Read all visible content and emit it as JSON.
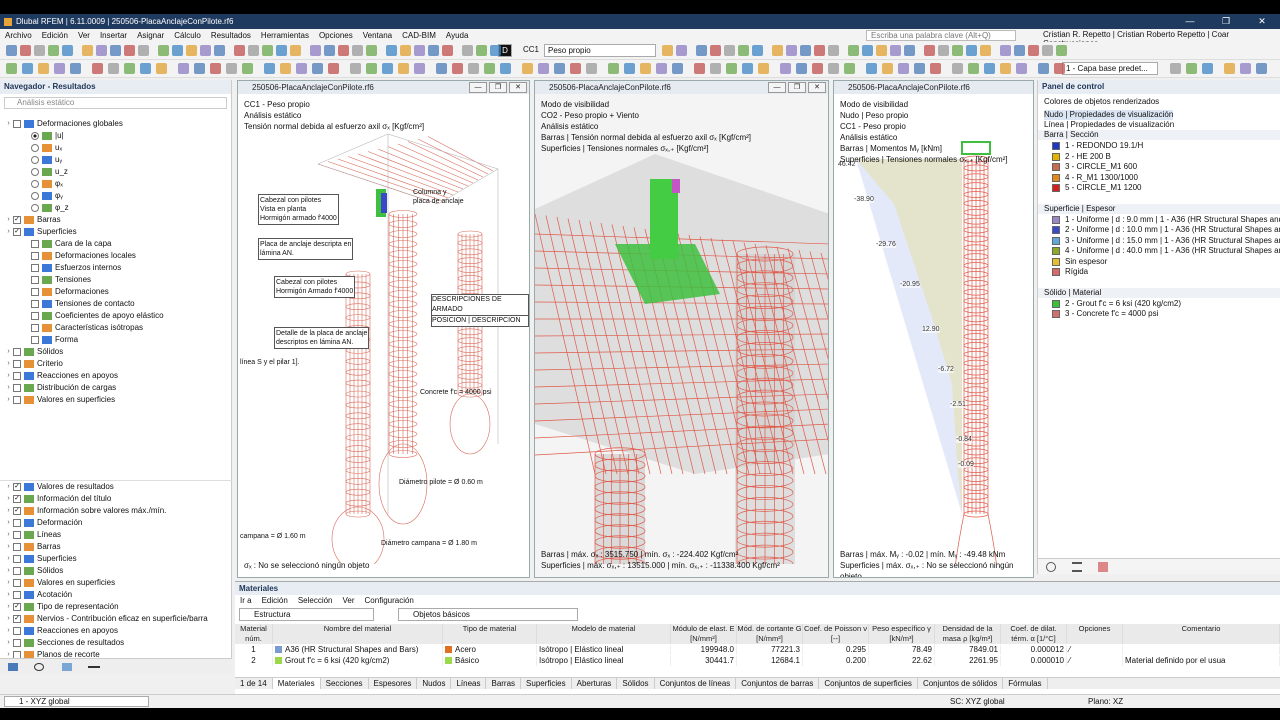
{
  "window": {
    "title": "Dlubal RFEM | 6.11.0009 | 250506-PlacaAnclajeConPilote.rf6",
    "min": "—",
    "max": "❐",
    "close": "✕"
  },
  "menu": [
    "Archivo",
    "Edición",
    "Ver",
    "Insertar",
    "Asignar",
    "Cálculo",
    "Resultados",
    "Herramientas",
    "Opciones",
    "Ventana",
    "CAD-BIM",
    "Ayuda"
  ],
  "search_placeholder": "Escriba una palabra clave (Alt+Q)",
  "user": "Cristian R. Repetto | Cristian Roberto Repetto | Coar Construcciones",
  "toolbar": {
    "load_case_badge": "D",
    "load_case_id": "CC1",
    "load_case_name": "Peso propio",
    "layer_combo": "1 - Capa base predet...",
    "coord_combo": "1 - XYZ global"
  },
  "navigator": {
    "title": "Navegador - Resultados",
    "subtitle": "Análisis estático",
    "top_tree": [
      {
        "label": "Deformaciones globales",
        "level": 0,
        "kind": "cb"
      },
      {
        "label": "|u|",
        "level": 1,
        "kind": "rb",
        "on": true
      },
      {
        "label": "uₓ",
        "level": 1,
        "kind": "rb"
      },
      {
        "label": "uᵧ",
        "level": 1,
        "kind": "rb"
      },
      {
        "label": "u_z",
        "level": 1,
        "kind": "rb"
      },
      {
        "label": "φₓ",
        "level": 1,
        "kind": "rb"
      },
      {
        "label": "φᵧ",
        "level": 1,
        "kind": "rb"
      },
      {
        "label": "φ_z",
        "level": 1,
        "kind": "rb"
      },
      {
        "label": "Barras",
        "level": 0,
        "kind": "cb",
        "checked": true
      },
      {
        "label": "Superficies",
        "level": 0,
        "kind": "cb",
        "checked": true
      },
      {
        "label": "Cara de la capa",
        "level": 1,
        "kind": "cb"
      },
      {
        "label": "Deformaciones locales",
        "level": 1,
        "kind": "cb"
      },
      {
        "label": "Esfuerzos internos",
        "level": 1,
        "kind": "cb"
      },
      {
        "label": "Tensiones",
        "level": 1,
        "kind": "cb"
      },
      {
        "label": "Deformaciones",
        "level": 1,
        "kind": "cb"
      },
      {
        "label": "Tensiones de contacto",
        "level": 1,
        "kind": "cb"
      },
      {
        "label": "Coeficientes de apoyo elástico",
        "level": 1,
        "kind": "cb"
      },
      {
        "label": "Características isótropas",
        "level": 1,
        "kind": "cb"
      },
      {
        "label": "Forma",
        "level": 1,
        "kind": "cb"
      },
      {
        "label": "Sólidos",
        "level": 0,
        "kind": "cb"
      },
      {
        "label": "Criterio",
        "level": 0,
        "kind": "cb"
      },
      {
        "label": "Reacciones en apoyos",
        "level": 0,
        "kind": "cb"
      },
      {
        "label": "Distribución de cargas",
        "level": 0,
        "kind": "cb"
      },
      {
        "label": "Valores en superficies",
        "level": 0,
        "kind": "cb"
      }
    ],
    "bottom_tree": [
      {
        "label": "Valores de resultados",
        "checked": true
      },
      {
        "label": "Información del título",
        "checked": true
      },
      {
        "label": "Información sobre valores máx./mín.",
        "checked": true
      },
      {
        "label": "Deformación",
        "checked": false
      },
      {
        "label": "Líneas",
        "checked": false
      },
      {
        "label": "Barras",
        "checked": false
      },
      {
        "label": "Superficies",
        "checked": false
      },
      {
        "label": "Sólidos",
        "checked": false
      },
      {
        "label": "Valores en superficies",
        "checked": false
      },
      {
        "label": "Acotación",
        "checked": false
      },
      {
        "label": "Tipo de representación",
        "checked": true
      },
      {
        "label": "Nervios - Contribución eficaz en superficie/barra",
        "checked": true
      },
      {
        "label": "Reacciones en apoyos",
        "checked": false
      },
      {
        "label": "Secciones de resultados",
        "checked": false
      },
      {
        "label": "Planos de recorte",
        "checked": false
      }
    ]
  },
  "views": [
    {
      "title": "250506-PlacaAnclajeConPilote.rf6",
      "lines": [
        "CC1 - Peso propio",
        "Análisis estático",
        "Tensión normal debida al esfuerzo axil σₓ [Kgf/cm²]"
      ],
      "footer": [
        "σₓ : No se seleccionó ningún objeto"
      ],
      "notes": [
        "Cabezal con pilotes",
        "Vista en planta",
        "Hormigón armado f'4000",
        "Columna y",
        "placa de anclaje",
        "Placa de anclaje descripta en",
        "lámina AN.",
        "Cabezal con pilotes",
        "Hormigón Armado f'4000",
        "Detalle de la placa de anclaje",
        "descriptos en lámina AN.",
        "Concrete f'c = 4000 psi",
        "DESCRIPCIONES DE ARMADO",
        "POSICION | DESCRIPCION",
        "Diámetro pilote = Ø 0.60 m",
        "Diámetro campana = Ø 1.80 m",
        "campana = Ø 1.60 m",
        "línea S y el pilar 1]."
      ]
    },
    {
      "title": "250506-PlacaAnclajeConPilote.rf6",
      "lines": [
        "Modo de visibilidad",
        "CO2 - Peso propio + Viento",
        "Análisis estático",
        "Barras | Tensión normal debida al esfuerzo axil σₓ [Kgf/cm²]",
        "Superficies | Tensiones normales σₓ,₊ [Kgf/cm²]"
      ],
      "footer": [
        "Barras | máx. σₓ : 3515.750 | mín. σₓ : -224.402 Kgf/cm²",
        "Superficies | máx. σₓ,₊ : 13515.000 | mín. σₓ,₊ : -11338.400 Kgf/cm²"
      ]
    },
    {
      "title": "250506-PlacaAnclajeConPilote.rf6",
      "lines": [
        "Modo de visibilidad",
        "Nudo | Peso propio",
        "CC1 - Peso propio",
        "Análisis estático",
        "Barras | Momentos Mᵧ [kNm]",
        "Superficies | Tensiones normales σₓ,₊ [Kgf/cm²]"
      ],
      "footer": [
        "Barras | máx. Mᵧ : -0.02 | mín. Mᵧ : -49.48 kNm",
        "Superficies | máx. σₓ,₊ : No se seleccionó ningún objeto"
      ],
      "moment_labels": [
        "46.42",
        "-38.90",
        "-29.76",
        "-20.95",
        "12.90",
        "-6.72",
        "-2.51",
        "-0.84",
        "-0.09"
      ]
    }
  ],
  "control_panel": {
    "title": "Panel de control",
    "subtitle": "Colores de objetos renderizados",
    "options": [
      "Nudo | Propiedades de visualización",
      "Línea | Propiedades de visualización"
    ],
    "sections": [
      {
        "title": "Barra | Sección",
        "items": [
          {
            "label": "1 - REDONDO 19.1/H",
            "color": "#1f36c4"
          },
          {
            "label": "2 - HE 200 B",
            "color": "#e2b400"
          },
          {
            "label": "3 - CIRCLE_M1 600",
            "color": "#c86b50"
          },
          {
            "label": "4 - R_M1 1300/1000",
            "color": "#e48a1a"
          },
          {
            "label": "5 - CIRCLE_M1 1200",
            "color": "#d62020"
          }
        ]
      },
      {
        "title": "Superficie | Espesor",
        "items": [
          {
            "label": "1 - Uniforme | d : 9.0 mm | 1 - A36 (HR Structural Shapes and Ba",
            "color": "#9a88c4"
          },
          {
            "label": "2 - Uniforme | d : 10.0 mm | 1 - A36 (HR Structural Shapes and B",
            "color": "#3a48c8"
          },
          {
            "label": "3 - Uniforme | d : 15.0 mm | 1 - A36 (HR Structural Shapes and B",
            "color": "#5fa8d8"
          },
          {
            "label": "4 - Uniforme | d : 40.0 mm | 1 - A36 (HR Structural Shapes and B",
            "color": "#8aaa2a"
          },
          {
            "label": "Sin espesor",
            "color": "#e6c02a"
          },
          {
            "label": "Rígida",
            "color": "#d86a6a"
          }
        ]
      },
      {
        "title": "Sólido | Material",
        "items": [
          {
            "label": "2 - Grout f'c = 6 ksi (420 kg/cm2)",
            "color": "#38c038"
          },
          {
            "label": "3 - Concrete f'c = 4000 psi",
            "color": "#d07070"
          }
        ]
      }
    ]
  },
  "materials": {
    "title": "Materiales",
    "menu": [
      "Ir a",
      "Edición",
      "Selección",
      "Ver",
      "Configuración"
    ],
    "combo1": "Estructura",
    "combo2": "Objetos básicos",
    "headers": [
      "Material núm.",
      "Nombre del material",
      "Tipo de material",
      "Modelo de material",
      "Módulo de elast. E [N/mm²]",
      "Mód. de cortante G [N/mm²]",
      "Coef. de Poisson ν [--]",
      "Peso específico γ [kN/m³]",
      "Densidad de la masa ρ [kg/m³]",
      "Coef. de dilat. térm. α [1/°C]",
      "Opciones",
      "Comentario"
    ],
    "rows": [
      {
        "num": "1",
        "name": "A36 (HR Structural Shapes and Bars)",
        "type": "Acero",
        "type_color": "#e07020",
        "model": "Isótropo | Elástico lineal",
        "E": "199948.0",
        "G": "77221.3",
        "nu": "0.295",
        "gamma": "78.49",
        "rho": "7849.01",
        "alpha": "0.000012",
        "comment": ""
      },
      {
        "num": "2",
        "name": "Grout f'c = 6 ksi (420 kg/cm2)",
        "type": "Básico",
        "type_color": "#9bd84a",
        "model": "Isótropo | Elástico lineal",
        "E": "30441.7",
        "G": "12684.1",
        "nu": "0.200",
        "gamma": "22.62",
        "rho": "2261.95",
        "alpha": "0.000010",
        "comment": "Material definido por el usua"
      }
    ],
    "pager": "1 de 14",
    "tabs": [
      "Materiales",
      "Secciones",
      "Espesores",
      "Nudos",
      "Líneas",
      "Barras",
      "Superficies",
      "Aberturas",
      "Sólidos",
      "Conjuntos de líneas",
      "Conjuntos de barras",
      "Conjuntos de superficies",
      "Conjuntos de sólidos",
      "Fórmulas"
    ]
  },
  "statusbar": {
    "sc": "SC: XYZ global",
    "plane": "Plano: XZ"
  }
}
